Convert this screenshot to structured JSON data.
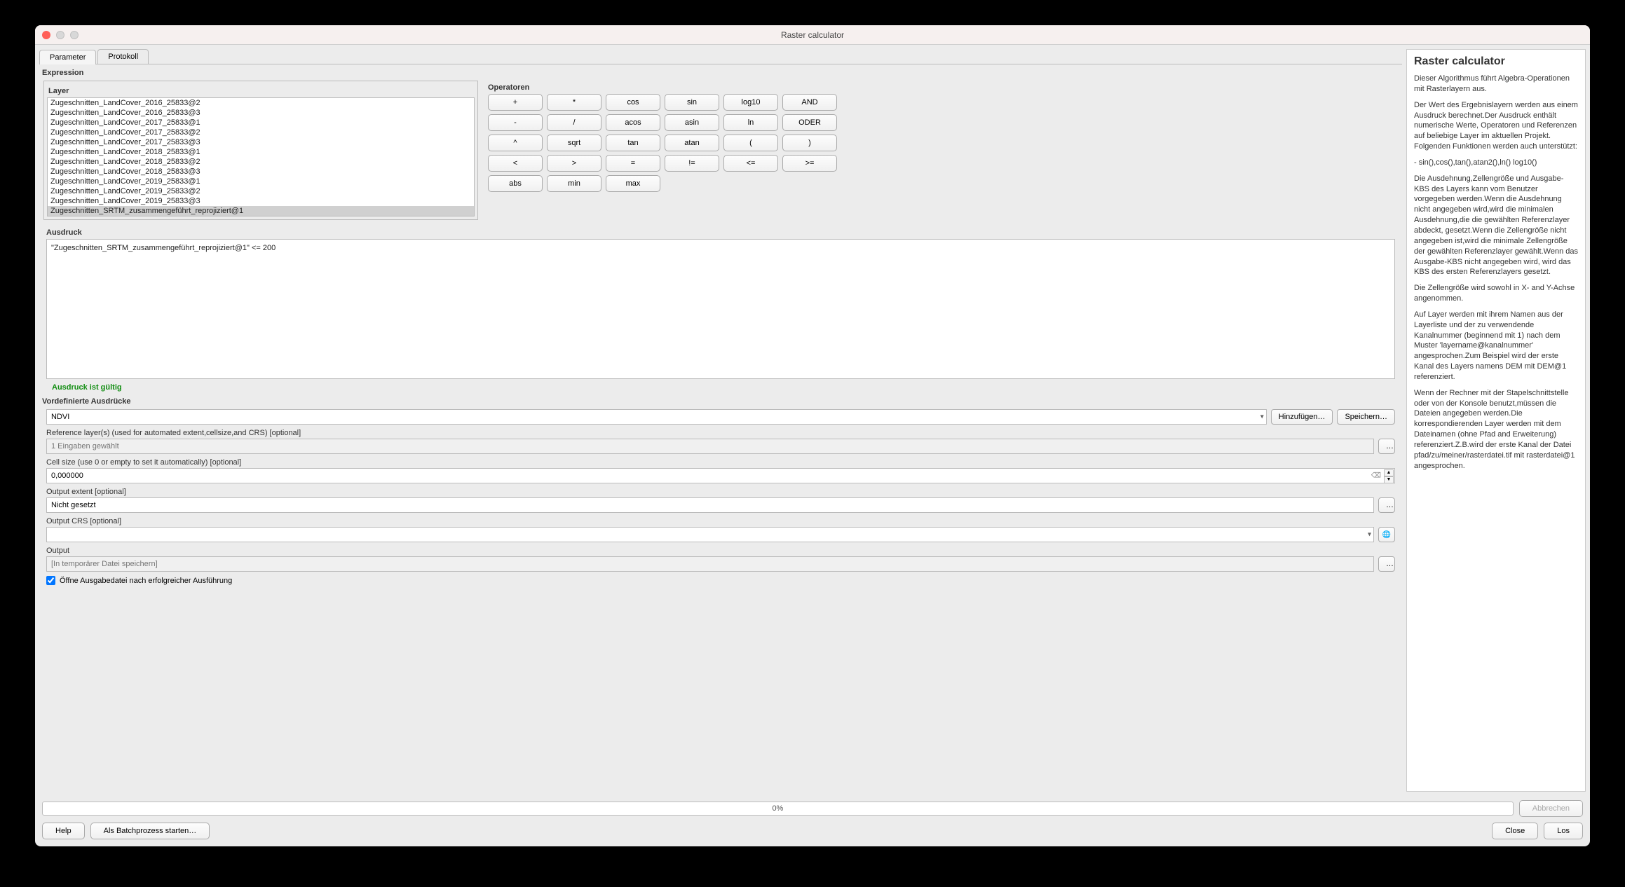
{
  "window_title": "Raster calculator",
  "tabs": {
    "parameter": "Parameter",
    "protokoll": "Protokoll"
  },
  "labels": {
    "expression": "Expression",
    "layer": "Layer",
    "operatoren": "Operatoren",
    "ausdruck": "Ausdruck",
    "valid": "Ausdruck ist gültig",
    "vordefinierte": "Vordefinierte Ausdrücke",
    "reference": "Reference layer(s) (used for automated extent,cellsize,and CRS) [optional]",
    "cellsize": "Cell size (use 0 or empty to set it automatically) [optional]",
    "extent": "Output extent [optional]",
    "crs": "Output CRS [optional]",
    "output": "Output",
    "open_after": "Öffne Ausgabedatei nach erfolgreicher Ausführung"
  },
  "layers": [
    "Zugeschnitten_LandCover_2016_25833@2",
    "Zugeschnitten_LandCover_2016_25833@3",
    "Zugeschnitten_LandCover_2017_25833@1",
    "Zugeschnitten_LandCover_2017_25833@2",
    "Zugeschnitten_LandCover_2017_25833@3",
    "Zugeschnitten_LandCover_2018_25833@1",
    "Zugeschnitten_LandCover_2018_25833@2",
    "Zugeschnitten_LandCover_2018_25833@3",
    "Zugeschnitten_LandCover_2019_25833@1",
    "Zugeschnitten_LandCover_2019_25833@2",
    "Zugeschnitten_LandCover_2019_25833@3",
    "Zugeschnitten_SRTM_zusammengeführt_reprojiziert@1"
  ],
  "operators": {
    "r1": [
      "+",
      "*",
      "cos",
      "sin",
      "log10",
      "AND"
    ],
    "r2": [
      "-",
      "/",
      "acos",
      "asin",
      "ln",
      "ODER"
    ],
    "r3": [
      "^",
      "sqrt",
      "tan",
      "atan",
      "(",
      ")"
    ],
    "r4": [
      "<",
      ">",
      "=",
      "!=",
      "<=",
      ">="
    ],
    "r5": [
      "abs",
      "min",
      "max"
    ]
  },
  "expr_value": "\"Zugeschnitten_SRTM_zusammengeführt_reprojiziert@1\" <= 200",
  "predef_value": "NDVI",
  "predef_buttons": {
    "add": "Hinzufügen…",
    "save": "Speichern…"
  },
  "reference_placeholder": "1 Eingaben gewählt",
  "cellsize_value": "0,000000",
  "extent_value": "Nicht gesetzt",
  "crs_value": "",
  "output_placeholder": "[In temporärer Datei speichern]",
  "progress": "0%",
  "footer": {
    "help": "Help",
    "batch": "Als Batchprozess starten…",
    "abbrechen": "Abbrechen",
    "close": "Close",
    "los": "Los"
  },
  "help": {
    "title": "Raster calculator",
    "p1": "Dieser Algorithmus führt Algebra-Operationen mit Rasterlayern aus.",
    "p2": "Der Wert des Ergebnislayern werden aus einem Ausdruck berechnet.Der Ausdruck enthält numerische Werte, Operatoren und Referenzen auf beliebige Layer im aktuellen Projekt. Folgenden Funktionen werden auch unterstützt:",
    "p3": "- sin(),cos(),tan(),atan2(),ln() log10()",
    "p4": "Die Ausdehnung,Zellengröße und Ausgabe-KBS des Layers kann vom Benutzer vorgegeben werden.Wenn die Ausdehnung nicht angegeben wird,wird die minimalen Ausdehnung,die die gewählten Referenzlayer abdeckt, gesetzt.Wenn die Zellengröße nicht angegeben ist,wird die minimale Zellengröße der gewählten Referenzlayer gewählt.Wenn das Ausgabe-KBS nicht angegeben wird, wird das KBS des ersten Referenzlayers gesetzt.",
    "p5": "Die Zellengröße wird sowohl in X- and Y-Achse angenommen.",
    "p6": "Auf Layer werden mit ihrem Namen aus der Layerliste und der zu verwendende Kanalnummer (beginnend mit 1) nach dem Muster 'layername@kanalnummer' angesprochen.Zum Beispiel wird der erste Kanal des Layers namens DEM mit DEM@1 referenziert.",
    "p7": "Wenn der Rechner mit der Stapelschnittstelle oder von der Konsole benutzt,müssen die Dateien angegeben werden.Die korrespondierenden Layer werden mit dem Dateinamen (ohne Pfad and Erweiterung) referenziert.Z.B.wird der erste Kanal der Datei pfad/zu/meiner/rasterdatei.tif mit rasterdatei@1 angesprochen."
  }
}
